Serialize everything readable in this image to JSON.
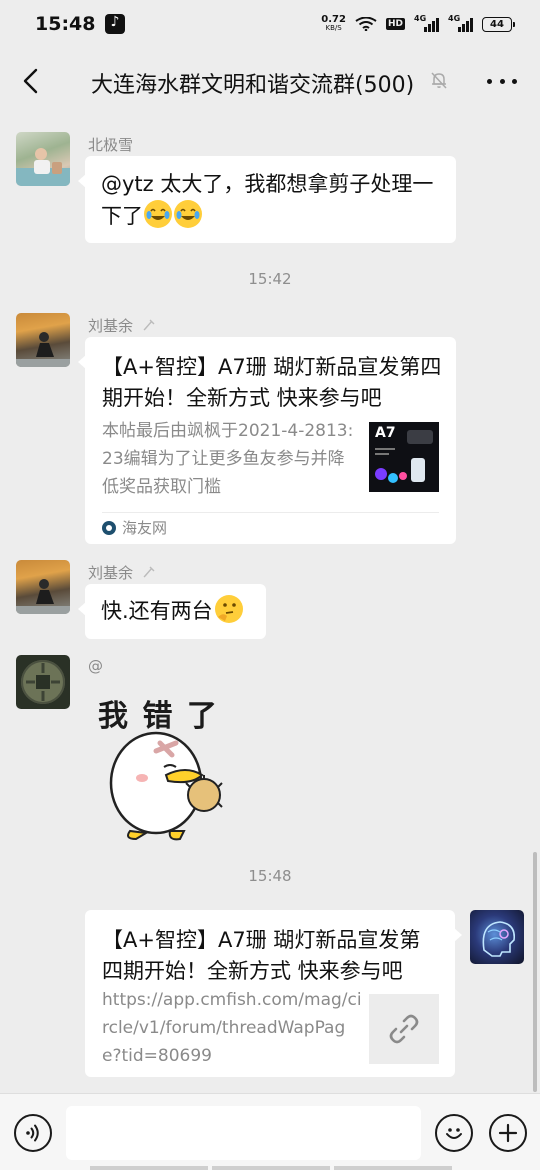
{
  "status_bar": {
    "time": "15:48",
    "net_speed": "0.72",
    "net_unit": "KB/S",
    "hd": "HD",
    "sig1": "4G",
    "sig2": "4G",
    "battery": "44"
  },
  "header": {
    "title": "大连海水群文明和谐交流群(500)",
    "back_icon": "back-chevron-icon",
    "mute_icon": "muted-bell-icon",
    "more_icon": "more-dots-icon"
  },
  "messages": [
    {
      "sender": "北极雪",
      "text": "@ytz  太大了，我都想拿剪子处理一下了"
    },
    {
      "time": "15:42"
    },
    {
      "sender": "刘基余",
      "card_title": "【A+智控】A7珊 瑚灯新品宣发第四期开始！全新方式  快来参与吧",
      "card_desc": "本帖最后由飒枫于2021-4-2813:23编辑为了让更多鱼友参与并降低奖品获取门槛",
      "card_thumb_label": "A7",
      "card_source": "海友网"
    },
    {
      "sender": "刘基余",
      "text": "快.还有两台"
    },
    {
      "sender": "@",
      "sticker_text": "我 错 了"
    },
    {
      "time": "15:48"
    },
    {
      "card_title": "【A+智控】A7珊 瑚灯新品宣发第四期开始！全新方式 快来参与吧",
      "card_desc": "https://app.cmfish.com/mag/circle/v1/forum/threadWapPage?tid=80699"
    }
  ],
  "colors": {
    "background": "#ededed",
    "bubble": "#ffffff",
    "meta_text": "#8a8a8a"
  },
  "input_bar": {
    "voice_icon": "voice-icon",
    "emoji_icon": "emoji-icon",
    "plus_icon": "plus-icon"
  }
}
